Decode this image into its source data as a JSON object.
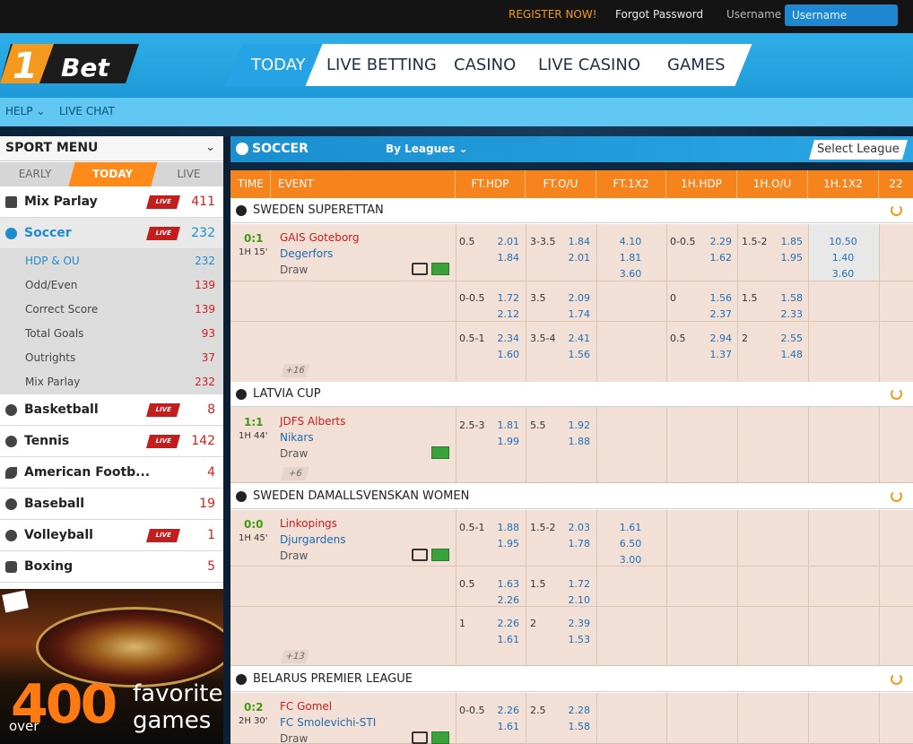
{
  "topbar": {
    "register": "REGISTER NOW!",
    "forgot": "Forgot Password",
    "username_label": "Username",
    "username_placeholder": "Username"
  },
  "logo": {
    "text_1": "1",
    "text_2": "Bet"
  },
  "nav": [
    {
      "label": "TODAY",
      "active": true
    },
    {
      "label": "LIVE BETTING"
    },
    {
      "label": "CASINO"
    },
    {
      "label": "LIVE CASINO"
    },
    {
      "label": "GAMES"
    }
  ],
  "subnav": {
    "help": "HELP",
    "live_chat": "LIVE CHAT"
  },
  "sport_menu": {
    "title": "SPORT MENU",
    "tabs": [
      "EARLY",
      "TODAY",
      "LIVE"
    ],
    "sports": [
      {
        "label": "Mix Parlay",
        "live": true,
        "count": "411"
      },
      {
        "label": "Soccer",
        "live": true,
        "count": "232",
        "selected": true
      },
      {
        "label": "Basketball",
        "live": true,
        "count": "8"
      },
      {
        "label": "Tennis",
        "live": true,
        "count": "142"
      },
      {
        "label": "American Footb...",
        "live": false,
        "count": "4"
      },
      {
        "label": "Baseball",
        "live": false,
        "count": "19"
      },
      {
        "label": "Volleyball",
        "live": true,
        "count": "1"
      },
      {
        "label": "Boxing",
        "live": false,
        "count": "5"
      }
    ],
    "soccer_sub": [
      {
        "label": "HDP & OU",
        "count": "232"
      },
      {
        "label": "Odd/Even",
        "count": "139"
      },
      {
        "label": "Correct Score",
        "count": "139"
      },
      {
        "label": "Total Goals",
        "count": "93"
      },
      {
        "label": "Outrights",
        "count": "37"
      },
      {
        "label": "Mix Parlay",
        "count": "232"
      }
    ],
    "live_badge": "LIVE"
  },
  "promo": {
    "over": "over",
    "number": "400",
    "line1": "favorite",
    "line2": "games"
  },
  "main": {
    "title": "SOCCER",
    "by_leagues": "By Leagues",
    "select_league": "Select League",
    "columns": [
      "TIME",
      "EVENT",
      "FT.HDP",
      "FT.O/U",
      "FT.1X2",
      "1H.HDP",
      "1H.O/U",
      "1H.1X2",
      "22"
    ]
  },
  "leagues": [
    {
      "name": "SWEDEN SUPERETTAN",
      "match": {
        "score": "0:1",
        "time": "1H 15'",
        "home": "GAIS Goteborg",
        "away": "Degerfors",
        "draw": "Draw",
        "more": "+16"
      },
      "lines": [
        {
          "ft_hdp": "0.5",
          "ft_hdp_h": "2.01",
          "ft_hdp_a": "1.84",
          "ft_ou": "3-3.5",
          "ft_ou_o": "1.84",
          "ft_ou_u": "2.01",
          "x12": [
            "4.10",
            "1.81",
            "3.60"
          ],
          "h1_hdp": "0-0.5",
          "h1_hdp_h": "2.29",
          "h1_hdp_a": "1.62",
          "h1_ou": "1.5-2",
          "h1_ou_o": "1.85",
          "h1_ou_u": "1.95",
          "h1_x12": [
            "10.50",
            "1.40",
            "3.60"
          ]
        },
        {
          "ft_hdp": "0-0.5",
          "ft_hdp_h": "1.72",
          "ft_hdp_a": "2.12",
          "ft_ou": "3.5",
          "ft_ou_o": "2.09",
          "ft_ou_u": "1.74",
          "h1_hdp": "0",
          "h1_hdp_h": "1.56",
          "h1_hdp_a": "2.37",
          "h1_ou": "1.5",
          "h1_ou_o": "1.58",
          "h1_ou_u": "2.33"
        },
        {
          "ft_hdp": "0.5-1",
          "ft_hdp_h": "2.34",
          "ft_hdp_a": "1.60",
          "ft_ou": "3.5-4",
          "ft_ou_o": "2.41",
          "ft_ou_u": "1.56",
          "h1_hdp": "0.5",
          "h1_hdp_h": "2.94",
          "h1_hdp_a": "1.37",
          "h1_ou": "2",
          "h1_ou_o": "2.55",
          "h1_ou_u": "1.48"
        }
      ]
    },
    {
      "name": "LATVIA CUP",
      "match": {
        "score": "1:1",
        "time": "1H 44'",
        "home": "JDFS Alberts",
        "away": "Nikars",
        "draw": "Draw",
        "more": "+6"
      },
      "lines": [
        {
          "ft_hdp": "2.5-3",
          "ft_hdp_h": "1.81",
          "ft_hdp_a": "1.99",
          "ft_ou": "5.5",
          "ft_ou_o": "1.92",
          "ft_ou_u": "1.88"
        }
      ]
    },
    {
      "name": "SWEDEN DAMALLSVENSKAN WOMEN",
      "match": {
        "score": "0:0",
        "time": "1H 45'",
        "home": "Linkopings",
        "away": "Djurgardens",
        "draw": "Draw",
        "more": "+13"
      },
      "lines": [
        {
          "ft_hdp": "0.5-1",
          "ft_hdp_h": "1.88",
          "ft_hdp_a": "1.95",
          "ft_ou": "1.5-2",
          "ft_ou_o": "2.03",
          "ft_ou_u": "1.78",
          "x12": [
            "1.61",
            "6.50",
            "3.00"
          ]
        },
        {
          "ft_hdp": "0.5",
          "ft_hdp_h": "1.63",
          "ft_hdp_a": "2.26",
          "ft_ou": "1.5",
          "ft_ou_o": "1.72",
          "ft_ou_u": "2.10"
        },
        {
          "ft_hdp": "1",
          "ft_hdp_h": "2.26",
          "ft_hdp_a": "1.61",
          "ft_ou": "2",
          "ft_ou_o": "2.39",
          "ft_ou_u": "1.53"
        }
      ]
    },
    {
      "name": "BELARUS PREMIER LEAGUE",
      "match": {
        "score": "0:2",
        "time": "2H 30'",
        "home": "FC Gomel",
        "away": "FC Smolevichi-STI",
        "draw": "Draw"
      },
      "lines": [
        {
          "ft_hdp": "0-0.5",
          "ft_hdp_h": "2.26",
          "ft_hdp_a": "1.61",
          "ft_ou": "2.5",
          "ft_ou_o": "2.28",
          "ft_ou_u": "1.58"
        }
      ]
    }
  ],
  "colors": {
    "brand_blue": "#2eaee8",
    "orange": "#f5841c",
    "live_red": "#c21e1e"
  }
}
